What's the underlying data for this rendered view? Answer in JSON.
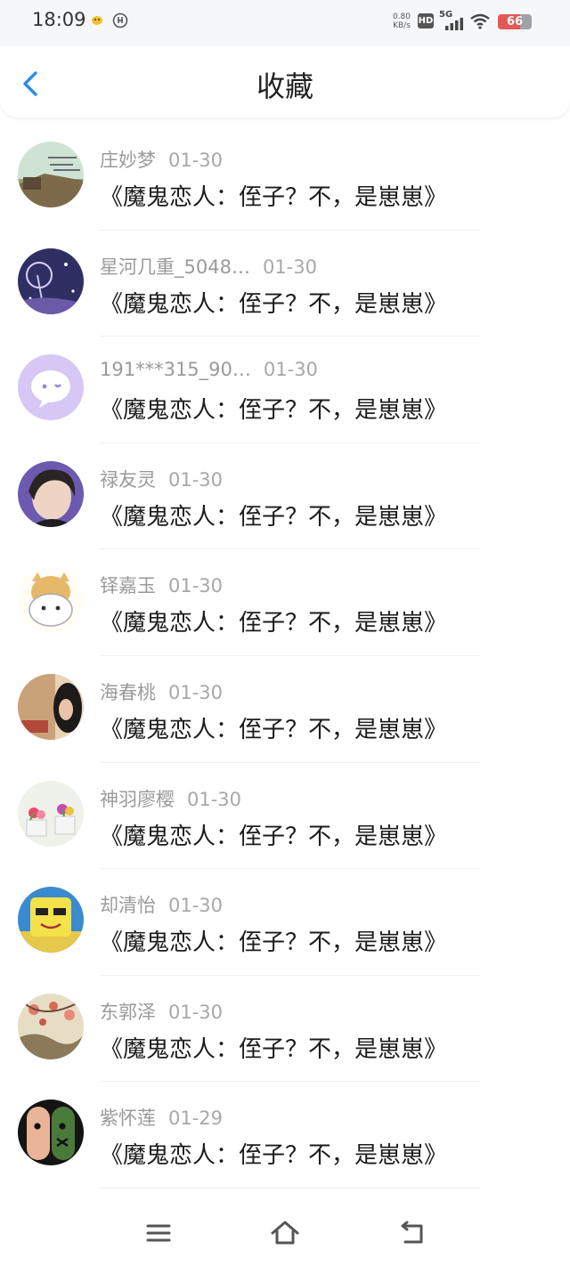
{
  "status_bar": {
    "time": "18:09",
    "net_speed_value": "0.80",
    "net_speed_unit": "KB/s",
    "hd": "HD",
    "net_type": "5G",
    "battery": "66",
    "battery_level": 0.66
  },
  "header": {
    "title": "收藏"
  },
  "colors": {
    "accent": "#2a8ee6",
    "battery": "#e45757"
  },
  "favorites": [
    {
      "user": "庄妙梦",
      "date": "01-30",
      "title": "《魔鬼恋人：侄子？不，是崽崽》"
    },
    {
      "user": "星河几重_5048…",
      "date": "01-30",
      "title": "《魔鬼恋人：侄子？不，是崽崽》"
    },
    {
      "user": "191***315_90…",
      "date": "01-30",
      "title": "《魔鬼恋人：侄子？不，是崽崽》"
    },
    {
      "user": "禄友灵",
      "date": "01-30",
      "title": "《魔鬼恋人：侄子？不，是崽崽》"
    },
    {
      "user": "铎嘉玉",
      "date": "01-30",
      "title": "《魔鬼恋人：侄子？不，是崽崽》"
    },
    {
      "user": "海春桃",
      "date": "01-30",
      "title": "《魔鬼恋人：侄子？不，是崽崽》"
    },
    {
      "user": "神羽廖樱",
      "date": "01-30",
      "title": "《魔鬼恋人：侄子？不，是崽崽》"
    },
    {
      "user": "却清怡",
      "date": "01-30",
      "title": "《魔鬼恋人：侄子？不，是崽崽》"
    },
    {
      "user": "东郭泽",
      "date": "01-30",
      "title": "《魔鬼恋人：侄子？不，是崽崽》"
    },
    {
      "user": "紫怀莲",
      "date": "01-29",
      "title": "《魔鬼恋人：侄子？不，是崽崽》"
    }
  ],
  "nav_bar": {
    "icons": [
      "menu-icon",
      "home-icon",
      "back-icon"
    ]
  }
}
